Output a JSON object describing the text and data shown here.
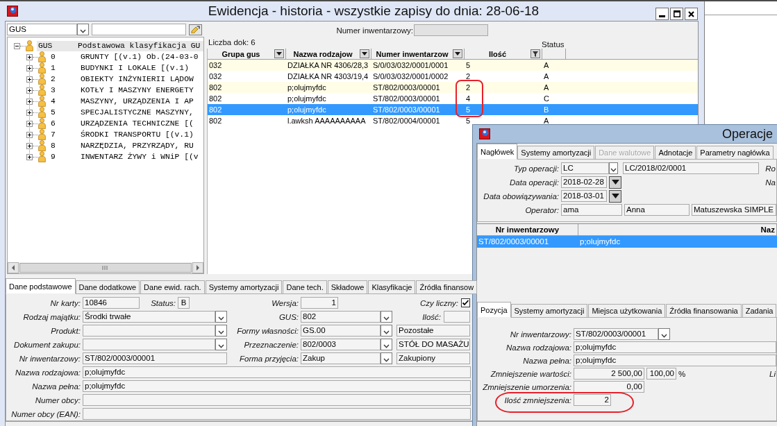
{
  "main_window": {
    "title": "Ewidencja - historia - wszystkie zapisy do dnia: 28-06-18",
    "classification": {
      "combo_value": "GUS",
      "tree": [
        {
          "code": "GUS",
          "label": "Podstawowa klasyfikacja GU",
          "expanded": true,
          "selected": true,
          "children": [
            {
              "code": "0",
              "label": "GRUNTY [(v.1) Ob.(24-03-0",
              "expanded": false,
              "selected": false
            },
            {
              "code": "1",
              "label": "BUDYNKI I LOKALE [(v.1)",
              "expanded": false,
              "selected": false
            },
            {
              "code": "2",
              "label": "OBIEKTY INŻYNIERII LĄDOW",
              "expanded": false,
              "selected": false
            },
            {
              "code": "3",
              "label": "KOTŁY I MASZYNY ENERGETY",
              "expanded": false,
              "selected": false
            },
            {
              "code": "4",
              "label": "MASZYNY, URZĄDZENIA I AP",
              "expanded": false,
              "selected": false
            },
            {
              "code": "5",
              "label": "SPECJALISTYCZNE MASZYNY,",
              "expanded": false,
              "selected": false
            },
            {
              "code": "6",
              "label": "URZĄDZENIA TECHNICZNE [(",
              "expanded": false,
              "selected": false
            },
            {
              "code": "7",
              "label": "ŚRODKI TRANSPORTU [(v.1)",
              "expanded": false,
              "selected": false
            },
            {
              "code": "8",
              "label": "NARZĘDZIA, PRZYRZĄDY, RU",
              "expanded": false,
              "selected": false
            },
            {
              "code": "9",
              "label": "INWENTARZ ŻYWY i WNiP [(v",
              "expanded": false,
              "selected": false
            }
          ]
        }
      ]
    },
    "documents": {
      "filter_label": "Numer inwentarzowy:",
      "count_label": "Liczba dok: 6",
      "status_label": "Status",
      "columns": [
        {
          "label": "Grupa gus",
          "filter_active": false
        },
        {
          "label": "Nazwa rodzajow",
          "filter_active": false
        },
        {
          "label": "Numer inwentarzow",
          "filter_active": false
        },
        {
          "label": "Ilość",
          "filter_active": true
        }
      ],
      "rows": [
        {
          "cells": [
            "032",
            "DZIAŁKA NR 4306/28,3",
            "S/0/03/032/0001/0001",
            "5",
            "A"
          ],
          "selected": false,
          "circled": false
        },
        {
          "cells": [
            "032",
            "DZIAŁKA NR 4303/19,4",
            "S/0/03/032/0001/0002",
            "2",
            "A"
          ],
          "selected": false,
          "circled": false
        },
        {
          "cells": [
            "802",
            "p;olujmyfdc",
            "ST/802/0003/00001",
            "2",
            "A"
          ],
          "selected": false,
          "circled": true
        },
        {
          "cells": [
            "802",
            "p;olujmyfdc",
            "ST/802/0003/00001",
            "4",
            "C"
          ],
          "selected": false,
          "circled": true
        },
        {
          "cells": [
            "802",
            "p;olujmyfdc",
            "ST/802/0003/00001",
            "5",
            "B"
          ],
          "selected": true,
          "circled": true
        },
        {
          "cells": [
            "802",
            "l.awksh AAAAAAAAAA",
            "ST/802/0004/00001",
            "5",
            "A"
          ],
          "selected": false,
          "circled": false
        }
      ]
    },
    "detail_tabs": [
      {
        "label": "Dane podstawowe",
        "selected": true
      },
      {
        "label": "Dane dodatkowe",
        "selected": false
      },
      {
        "label": "Dane ewid. rach.",
        "selected": false
      },
      {
        "label": "Systemy amortyzacji",
        "selected": false
      },
      {
        "label": "Dane tech.",
        "selected": false
      },
      {
        "label": "Składowe",
        "selected": false
      },
      {
        "label": "Klasyfikacje",
        "selected": false
      },
      {
        "label": "Źródła finansow",
        "selected": false
      }
    ],
    "details": {
      "left_fields": [
        {
          "kind": "card",
          "label": "Nr karty:",
          "value": "10846",
          "status_label": "Status:",
          "status_value": "B"
        },
        {
          "kind": "combo",
          "label": "Rodzaj majątku:",
          "value": "Środki trwałe"
        },
        {
          "kind": "combo",
          "label": "Produkt:"
        },
        {
          "kind": "combo",
          "label": "Dokument zakupu:"
        },
        {
          "kind": "text",
          "label": "Nr inwentarzowy:",
          "value": "ST/802/0003/00001"
        }
      ],
      "middle_fields": [
        {
          "kind": "number",
          "label": "Wersja:",
          "value": "1"
        },
        {
          "kind": "combo",
          "label": "GUS:",
          "value": "802"
        },
        {
          "kind": "combo",
          "label": "Formy własności:",
          "value": "GS.00",
          "description": "Pozostałe"
        },
        {
          "kind": "combo",
          "label": "Przeznaczenie:",
          "value": "802/0003",
          "description": "STÓŁ DO MASAŻU"
        },
        {
          "kind": "combo",
          "label": "Forma przyjęcia:",
          "value": "Zakup",
          "description": "Zakupiony"
        }
      ],
      "side_fields": [
        {
          "kind": "checkbox",
          "label": "Czy liczny:",
          "checked": true
        },
        {
          "kind": "number",
          "label": "Ilość:"
        }
      ],
      "wide_fields": [
        {
          "label": "Nazwa rodzajowa:",
          "value": "p;olujmyfdc"
        },
        {
          "label": "Nazwa pełna:",
          "value": "p;olujmyfdc"
        },
        {
          "label": "Numer obcy:"
        },
        {
          "label": "Numer obcy (EAN):"
        }
      ]
    }
  },
  "dialog": {
    "title": "Operacje",
    "header_tabs": [
      {
        "label": "Nagłówek",
        "selected": true,
        "disabled": false
      },
      {
        "label": "Systemy amortyzacji",
        "selected": false,
        "disabled": false
      },
      {
        "label": "Dane walutowe",
        "selected": false,
        "disabled": true
      },
      {
        "label": "Adnotacje",
        "selected": false,
        "disabled": false
      },
      {
        "label": "Parametry nagłówka",
        "selected": false,
        "disabled": false
      }
    ],
    "header_fields": [
      {
        "kind": "combo",
        "label": "Typ operacji:",
        "value": "LC",
        "description": "LC/2018/02/0001",
        "side_label": "Ro"
      },
      {
        "kind": "date",
        "label": "Data operacji:",
        "value": "2018-02-28",
        "side_label": "Na"
      },
      {
        "kind": "date",
        "label": "Data obowiązywania:",
        "value": "2018-03-01"
      },
      {
        "kind": "multi",
        "label": "Operator:",
        "values": [
          "ama",
          "Anna",
          "Matuszewska SIMPLE"
        ]
      }
    ],
    "positions": {
      "columns": [
        "Nr inwentarzowy",
        "Naz"
      ],
      "rows": [
        {
          "cells": [
            "ST/802/0003/00001",
            "p;olujmyfdc"
          ],
          "selected": true
        }
      ]
    },
    "position_tabs": [
      {
        "label": "Pozycja",
        "selected": true
      },
      {
        "label": "Systemy amortyzacji",
        "selected": false
      },
      {
        "label": "Miejsca użytkowania",
        "selected": false
      },
      {
        "label": "Źródła finansowania",
        "selected": false
      },
      {
        "label": "Zadania",
        "selected": false
      }
    ],
    "position_fields": [
      {
        "kind": "combo",
        "label": "Nr inwentarzowy:",
        "value": "ST/802/0003/00001",
        "circled": false
      },
      {
        "kind": "text",
        "label": "Nazwa rodzajowa:",
        "value": "p;olujmyfdc",
        "circled": false
      },
      {
        "kind": "text",
        "label": "Nazwa pełna:",
        "value": "p;olujmyfdc",
        "circled": false
      },
      {
        "kind": "amount",
        "label": "Zmniejszenie wartości:",
        "value": "2 500,00",
        "percent": "100,00",
        "unit": "%",
        "side_label": "Li",
        "circled": false
      },
      {
        "kind": "amount",
        "label": "Zmniejszenie umorzenia:",
        "value": "0,00",
        "circled": false
      },
      {
        "kind": "count",
        "label": "Ilość zmniejszenia:",
        "value": "2",
        "circled": true
      }
    ]
  }
}
